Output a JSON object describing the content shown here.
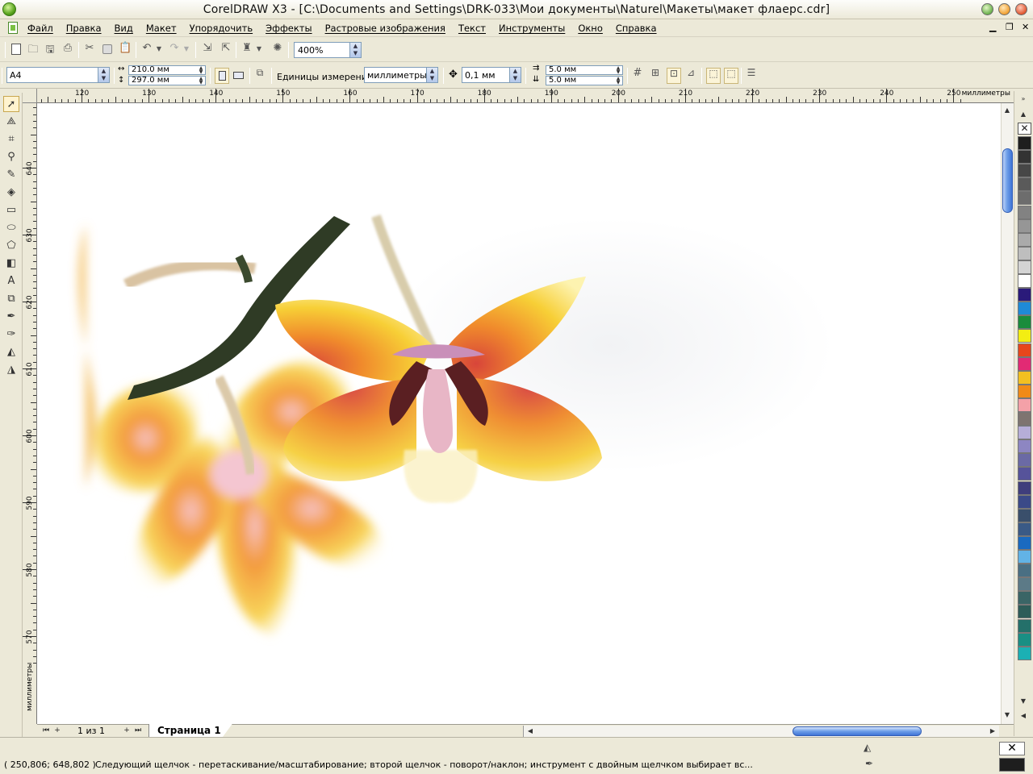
{
  "window": {
    "title": "CorelDRAW X3 - [C:\\Documents and Settings\\DRK-033\\Мои документы\\Naturel\\Макеты\\макет флаерс.cdr]"
  },
  "menu": {
    "items": [
      "Файл",
      "Правка",
      "Вид",
      "Макет",
      "Упорядочить",
      "Эффекты",
      "Растровые изображения",
      "Текст",
      "Инструменты",
      "Окно",
      "Справка"
    ]
  },
  "toolbar": {
    "zoom": "400%"
  },
  "property_bar": {
    "paper_size": "A4",
    "width": "210.0 мм",
    "height": "297.0 мм",
    "units_label": "Единицы измерения:",
    "units_value": "миллиметры",
    "nudge": "0,1 мм",
    "duplicate_x": "5.0 мм",
    "duplicate_y": "5.0 мм"
  },
  "rulers": {
    "unit": "миллиметры",
    "h_labels": [
      "120",
      "130",
      "140",
      "150",
      "160",
      "170",
      "180",
      "190",
      "200",
      "210",
      "220",
      "230",
      "240",
      "250"
    ],
    "v_labels": [
      "640",
      "630",
      "620",
      "610",
      "600",
      "590",
      "580",
      "570"
    ]
  },
  "pages": {
    "count": "1 из 1",
    "tab": "Страница 1"
  },
  "palette": {
    "colors": [
      "#1e1e1e",
      "#333333",
      "#474747",
      "#5a5a5a",
      "#6d6d6d",
      "#828282",
      "#969696",
      "#aaaaaa",
      "#bebebe",
      "#d4d4d4",
      "#ffffff",
      "#2a1a7a",
      "#1f8ad8",
      "#1a8c3c",
      "#f3ee12",
      "#e7461b",
      "#e22a74",
      "#f2c021",
      "#f08a17",
      "#f4a1a8",
      "#7e7470",
      "#b6aed8",
      "#8d86c2",
      "#6b6aa5",
      "#56539a",
      "#3f3e7c",
      "#3b4a88",
      "#3a4f6b",
      "#3a5a86",
      "#1a6ac0",
      "#62b3e6",
      "#4a6f83",
      "#5c7a87",
      "#3a6566",
      "#2d5c58",
      "#24706a",
      "#198f84",
      "#1bb0b4"
    ]
  },
  "status": {
    "coords": "( 250,806; 648,802 )",
    "message": "Следующий щелчок - перетаскивание/масштабирование; второй щелчок - поворот/наклон; инструмент с двойным щелчком выбирает вс..."
  }
}
